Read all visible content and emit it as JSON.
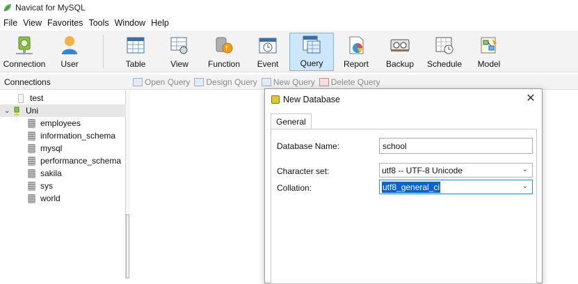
{
  "window": {
    "title": "Navicat for MySQL"
  },
  "menu": [
    "File",
    "View",
    "Favorites",
    "Tools",
    "Window",
    "Help"
  ],
  "toolbar": {
    "connection": "Connection",
    "user": "User",
    "table": "Table",
    "view": "View",
    "function": "Function",
    "event": "Event",
    "query": "Query",
    "report": "Report",
    "backup": "Backup",
    "schedule": "Schedule",
    "model": "Model"
  },
  "connections_header": "Connections",
  "object_toolbar": {
    "open_query": "Open Query",
    "design_query": "Design Query",
    "new_query": "New Query",
    "delete_query": "Delete Query"
  },
  "tree": {
    "conn_test": "test",
    "conn_uni": "Uni",
    "databases": [
      "employees",
      "information_schema",
      "mysql",
      "performance_schema",
      "sakila",
      "sys",
      "world"
    ]
  },
  "dialog": {
    "title": "New Database",
    "close": "✕",
    "tab_general": "General",
    "db_name_label": "Database Name:",
    "db_name_value": "school",
    "charset_label": "Character set:",
    "charset_value": "utf8 -- UTF-8 Unicode",
    "collation_label": "Collation:",
    "collation_value": "utf8_general_ci"
  }
}
